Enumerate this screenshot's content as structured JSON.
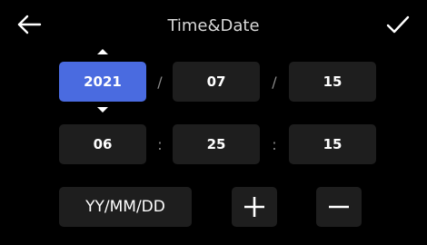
{
  "header": {
    "title": "Time&Date",
    "back_icon": "arrow-left-icon",
    "confirm_icon": "checkmark-icon"
  },
  "date": {
    "year": "2021",
    "month": "07",
    "day": "15",
    "separator": "/",
    "selected_field": "year"
  },
  "time": {
    "hour": "06",
    "minute": "25",
    "second": "15",
    "separator": ":"
  },
  "controls": {
    "format_label": "YY/MM/DD",
    "increment_icon": "plus-icon",
    "decrement_icon": "minus-icon"
  },
  "colors": {
    "background": "#000000",
    "field_bg": "#1e1e1e",
    "accent": "#4a6be0",
    "text": "#ffffff"
  }
}
